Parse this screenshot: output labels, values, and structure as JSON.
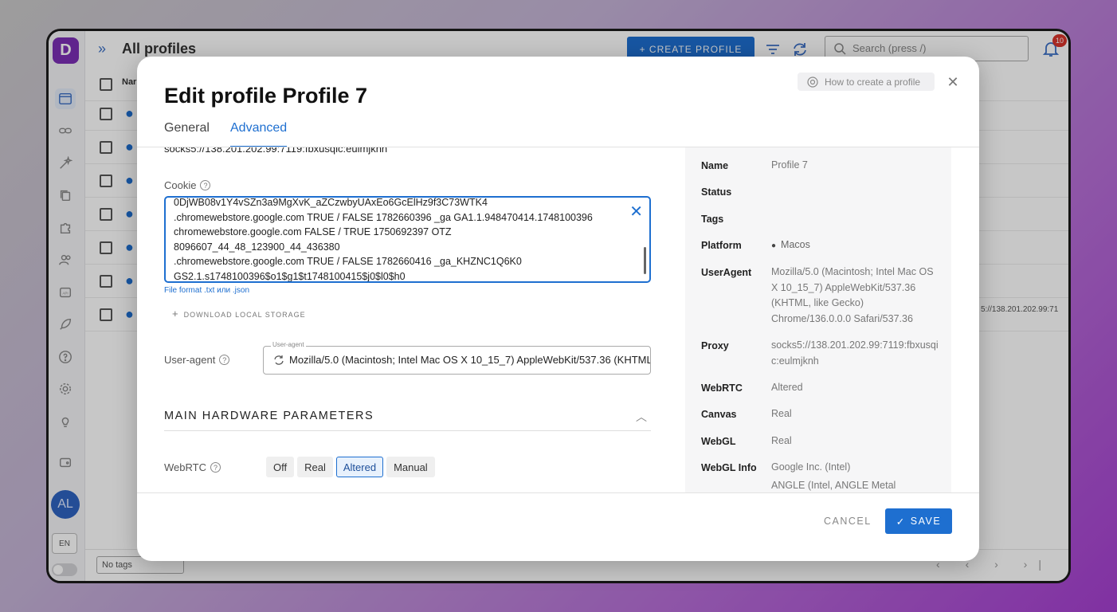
{
  "app": {
    "logo_letter": "D",
    "page_title": "All profiles",
    "create_label": "+ CREATE PROFILE",
    "search_placeholder": "Search (press /)",
    "notifications_count": "10",
    "avatar_initials": "AL",
    "language": "EN",
    "table_header_name": "Nar",
    "bg_proxy_cut": "5://138.201.202.99:71",
    "no_tags_label": "No tags",
    "pager": "‹ ‹ › ›|",
    "sidebar_icons": [
      "browser-icon",
      "link-icon",
      "magic-icon",
      "copy-icon",
      "puzzle-icon",
      "users-icon",
      "api-icon",
      "rocket-icon",
      "help-icon",
      "gear-icon",
      "bulb-icon",
      "wallet-icon"
    ]
  },
  "modal": {
    "title": "Edit profile Profile 7",
    "how_to": "How to create a profile",
    "tabs": [
      {
        "label": "General"
      },
      {
        "label": "Advanced"
      }
    ],
    "active_tab": "Advanced",
    "proxy_cut_value": "socks5://138.201.202.99:7119:fbxusqic:eulmjknh",
    "cookie": {
      "label": "Cookie",
      "lines": [
        "0DjWB08v1Y4vSZn3a9MgXvK_aZCzwbyUAxEo6GcElHz9f3C73WTK4",
        ".chromewebstore.google.com  TRUE  /  FALSE 1782660396 _ga  GA1.1.948470414.1748100396",
        "chromewebstore.google.com   FALSE /  TRUE  1750692397 OTZ",
        "8096607_44_48_123900_44_436380",
        ".chromewebstore.google.com  TRUE  /  FALSE 1782660416 _ga_KHZNC1Q6K0",
        "GS2.1.s1748100396$o1$g1$t1748100415$j0$l0$h0"
      ],
      "file_hint": "File format .txt или .json"
    },
    "download_local_storage": "DOWNLOAD LOCAL STORAGE",
    "user_agent": {
      "label": "User-agent",
      "legend": "User-agent",
      "value": "Mozilla/5.0 (Macintosh; Intel Mac OS X 10_15_7) AppleWebKit/537.36 (KHTML,..."
    },
    "hardware_section_title": "MAIN HARDWARE PARAMETERS",
    "webrtc": {
      "label": "WebRTC",
      "options": [
        "Off",
        "Real",
        "Altered",
        "Manual"
      ],
      "selected": "Altered"
    },
    "summary": [
      {
        "key": "Name",
        "value": "Profile 7"
      },
      {
        "key": "Status",
        "value": ""
      },
      {
        "key": "Tags",
        "value": ""
      },
      {
        "key": "Platform",
        "value": "Macos"
      },
      {
        "key": "UserAgent",
        "value": "Mozilla/5.0 (Macintosh; Intel Mac OS X 10_15_7) AppleWebKit/537.36 (KHTML, like Gecko) Chrome/136.0.0.0 Safari/537.36"
      },
      {
        "key": "Proxy",
        "value": "socks5://138.201.202.99:7119:fbxusqic:eulmjknh"
      },
      {
        "key": "WebRTC",
        "value": "Altered"
      },
      {
        "key": "Canvas",
        "value": "Real"
      },
      {
        "key": "WebGL",
        "value": "Real"
      },
      {
        "key": "WebGL Info",
        "value": "Google Inc. (Intel)"
      },
      {
        "key": "",
        "value": "ANGLE (Intel, ANGLE Metal Renderer: Intel(R) Iris(TM) Plus"
      }
    ],
    "cancel_label": "CANCEL",
    "save_label": "SAVE"
  },
  "colors": {
    "accent": "#1e6fd0",
    "brand": "#7b2fb5",
    "badge": "#d8342b"
  }
}
